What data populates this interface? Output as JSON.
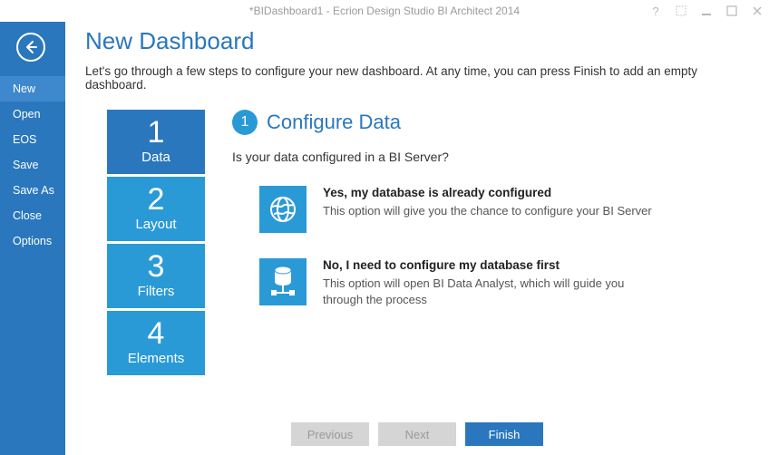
{
  "window": {
    "title": "*BIDashboard1 - Ecrion Design Studio BI Architect 2014"
  },
  "sidebar": {
    "items": [
      {
        "label": "New",
        "selected": true
      },
      {
        "label": "Open",
        "selected": false
      },
      {
        "label": "EOS",
        "selected": false
      },
      {
        "label": "Save",
        "selected": false
      },
      {
        "label": "Save As",
        "selected": false
      },
      {
        "label": "Close",
        "selected": false
      },
      {
        "label": "Options",
        "selected": false
      }
    ]
  },
  "page": {
    "title": "New Dashboard",
    "intro": "Let's go through a few steps to configure your new dashboard. At any time, you can press Finish to add an empty dashboard."
  },
  "steps": [
    {
      "num": "1",
      "label": "Data",
      "active": true
    },
    {
      "num": "2",
      "label": "Layout",
      "active": false
    },
    {
      "num": "3",
      "label": "Filters",
      "active": false
    },
    {
      "num": "4",
      "label": "Elements",
      "active": false
    }
  ],
  "section": {
    "badge": "1",
    "title": "Configure Data",
    "question": "Is your data configured in a BI Server?"
  },
  "options": [
    {
      "title": "Yes, my database is already configured",
      "desc": "This option will give you the chance to configure your BI Server",
      "icon": "globe-icon"
    },
    {
      "title": "No, I need to configure my database first",
      "desc": "This option will open BI Data Analyst, which will guide you through the process",
      "icon": "database-icon"
    }
  ],
  "buttons": {
    "previous": "Previous",
    "next": "Next",
    "finish": "Finish"
  }
}
